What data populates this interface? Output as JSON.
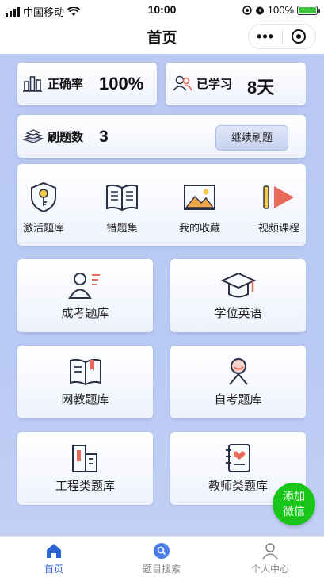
{
  "status_bar": {
    "carrier": "中国移动",
    "time": "10:00",
    "battery": "100%"
  },
  "nav": {
    "title": "首页",
    "more": "•••"
  },
  "stats": {
    "accuracy_label": "正确率",
    "accuracy_value": "100%",
    "studied_label": "已学习",
    "studied_value": "8天",
    "practiced_label": "刷题数",
    "practiced_value": "3",
    "continue_button": "继续刷题"
  },
  "quick_links": [
    {
      "label": "激活题库",
      "icon": "key-shield-icon"
    },
    {
      "label": "错题集",
      "icon": "book-icon"
    },
    {
      "label": "我的收藏",
      "icon": "image-icon"
    },
    {
      "label": "视频课程",
      "icon": "play-icon"
    }
  ],
  "categories": [
    {
      "label": "成考题库",
      "icon": "person-edit-icon"
    },
    {
      "label": "学位英语",
      "icon": "graduation-cap-icon"
    },
    {
      "label": "网教题库",
      "icon": "open-book-icon"
    },
    {
      "label": "自考题库",
      "icon": "person-icon"
    },
    {
      "label": "工程类题库",
      "icon": "building-icon"
    },
    {
      "label": "教师类题库",
      "icon": "notebook-heart-icon"
    }
  ],
  "fab": {
    "line1": "添加",
    "line2": "微信"
  },
  "tabs": [
    {
      "label": "首页",
      "icon": "home-icon",
      "active": true
    },
    {
      "label": "题目搜索",
      "icon": "search-icon",
      "active": false
    },
    {
      "label": "个人中心",
      "icon": "user-icon",
      "active": false
    }
  ],
  "colors": {
    "accent": "#2b62d6",
    "background": "#b9c9f3",
    "fab": "#19c519",
    "icon_stroke": "#2a2f45",
    "icon_highlight": "#e86a5a"
  }
}
